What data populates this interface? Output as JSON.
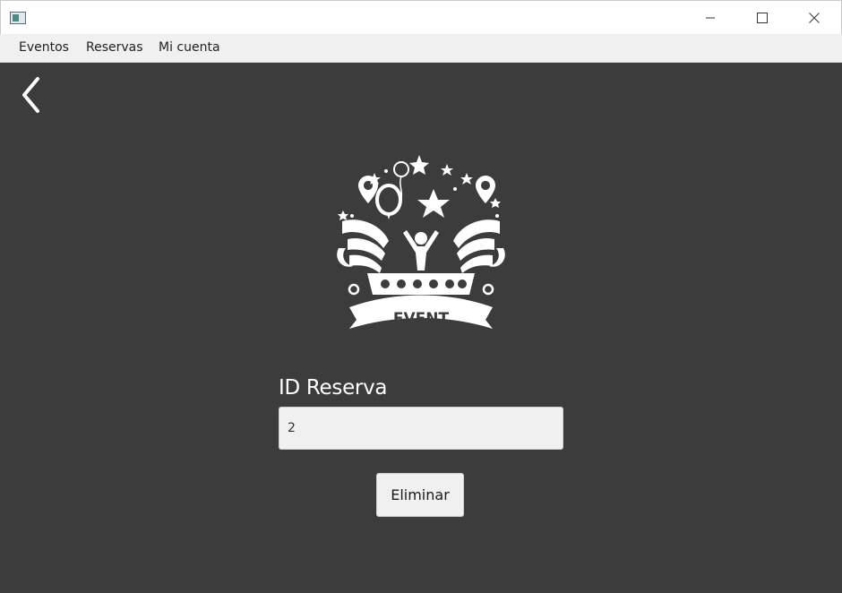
{
  "window": {
    "controls": {
      "minimize_icon": "minimize-icon",
      "maximize_icon": "maximize-icon",
      "close_icon": "close-icon"
    }
  },
  "menu": {
    "items": [
      {
        "label": "Eventos"
      },
      {
        "label": "Reservas"
      },
      {
        "label": "Mi cuenta"
      }
    ]
  },
  "nav": {
    "back_icon": "chevron-left-icon"
  },
  "logo": {
    "text": "EVENT",
    "icon": "event-crest-logo"
  },
  "form": {
    "id_label": "ID Reserva",
    "id_value": "2",
    "submit_label": "Eliminar"
  }
}
